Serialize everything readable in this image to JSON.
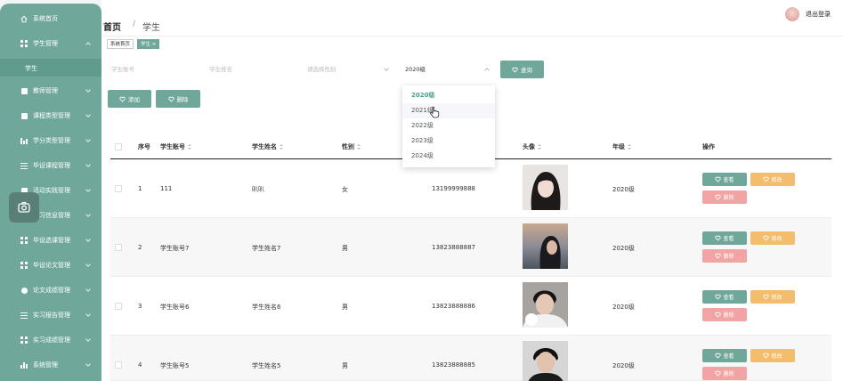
{
  "sidebar": {
    "items": [
      {
        "label": "系统首页",
        "icon": "home-icon"
      },
      {
        "label": "学生管理",
        "icon": "grid-icon"
      },
      {
        "label": "教师管理",
        "icon": "briefcase-icon"
      },
      {
        "label": "课程类型管理",
        "icon": "doc-icon"
      },
      {
        "label": "学分类型管理",
        "icon": "chart-icon"
      },
      {
        "label": "毕设课程管理",
        "icon": "list-icon"
      },
      {
        "label": "活动实践管理",
        "icon": "doc-icon"
      },
      {
        "label": "实习信息管理",
        "icon": "grid-icon"
      },
      {
        "label": "毕设选课管理",
        "icon": "grid-icon"
      },
      {
        "label": "毕设论文管理",
        "icon": "grid-icon"
      },
      {
        "label": "论文成绩管理",
        "icon": "location-icon"
      },
      {
        "label": "实习报告管理",
        "icon": "list-icon"
      },
      {
        "label": "实习成绩管理",
        "icon": "grid-icon"
      },
      {
        "label": "系统管理",
        "icon": "chart-icon"
      }
    ],
    "sub_item": "学生"
  },
  "header": {
    "crumb_home": "首页",
    "crumb_sep": "/",
    "crumb_current": "学生",
    "logout": "退出登录"
  },
  "tags": {
    "home": "系统首页",
    "current": "学生 ×"
  },
  "filters": {
    "account_placeholder": "学生账号",
    "name_placeholder": "学生姓名",
    "gender_placeholder": "请选择性别",
    "grade_value": "2020级",
    "search_label": "查询"
  },
  "actions": {
    "add_label": "添加",
    "delete_label": "删除"
  },
  "dropdown": {
    "options": [
      "2020级",
      "2021级",
      "2022级",
      "2023级",
      "2024级"
    ],
    "selected": "2020级",
    "hovered": "2021级"
  },
  "table": {
    "headers": [
      "序号",
      "学生账号",
      "学生姓名",
      "性别",
      "",
      "头像",
      "年级",
      "操作"
    ],
    "rows": [
      {
        "no": "1",
        "account": "111",
        "name": "叭叭",
        "gender": "女",
        "phone": "13199999888",
        "grade": "2020级"
      },
      {
        "no": "2",
        "account": "学生账号7",
        "name": "学生姓名7",
        "gender": "男",
        "phone": "13823888887",
        "grade": "2020级"
      },
      {
        "no": "3",
        "account": "学生账号6",
        "name": "学生姓名6",
        "gender": "男",
        "phone": "13823888886",
        "grade": "2020级"
      },
      {
        "no": "4",
        "account": "学生账号5",
        "name": "学生姓名5",
        "gender": "男",
        "phone": "13823888885",
        "grade": "2020级"
      }
    ],
    "view_label": "查看",
    "edit_label": "修改",
    "delete_label": "删除"
  },
  "colors": {
    "sidebar": "#6fa89a",
    "primary": "#6fa89a",
    "edit": "#f3bd6d",
    "delete": "#f2a3a3"
  }
}
